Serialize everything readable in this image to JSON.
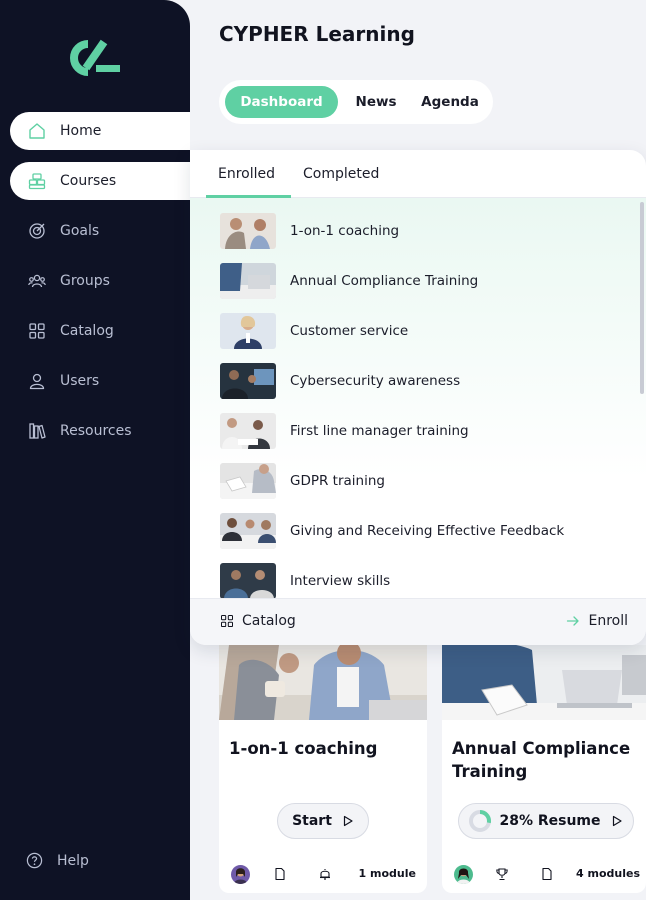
{
  "app": {
    "title": "CYPHER Learning"
  },
  "sidebar": {
    "items": [
      {
        "label": "Home",
        "icon": "home-icon",
        "active": true
      },
      {
        "label": "Courses",
        "icon": "courses-icon",
        "active": true
      },
      {
        "label": "Goals",
        "icon": "goals-icon",
        "active": false
      },
      {
        "label": "Groups",
        "icon": "groups-icon",
        "active": false
      },
      {
        "label": "Catalog",
        "icon": "catalog-icon",
        "active": false
      },
      {
        "label": "Users",
        "icon": "users-icon",
        "active": false
      },
      {
        "label": "Resources",
        "icon": "resources-icon",
        "active": false
      }
    ],
    "help_label": "Help"
  },
  "header_tabs": [
    {
      "label": "Dashboard",
      "active": true
    },
    {
      "label": "News",
      "active": false
    },
    {
      "label": "Agenda",
      "active": false
    }
  ],
  "courses_panel": {
    "tabs": [
      {
        "label": "Enrolled",
        "active": true
      },
      {
        "label": "Completed",
        "active": false
      }
    ],
    "items": [
      "1-on-1 coaching",
      "Annual Compliance Training",
      "Customer service",
      "Cybersecurity awareness",
      "First line manager training",
      "GDPR training",
      "Giving and Receiving Effective Feedback",
      "Interview skills"
    ],
    "footer": {
      "catalog_label": "Catalog",
      "enroll_label": "Enroll"
    }
  },
  "cards": [
    {
      "title": "1-on-1 coaching",
      "button_label": "Start",
      "modules": "1 module"
    },
    {
      "title": "Annual Compliance Training",
      "button_label": "28% Resume",
      "progress": 0.28,
      "modules": "4 modules"
    }
  ],
  "colors": {
    "accent": "#5fd0a3",
    "sidebar_bg": "#0e1225",
    "page_bg": "#f2f3f7"
  }
}
